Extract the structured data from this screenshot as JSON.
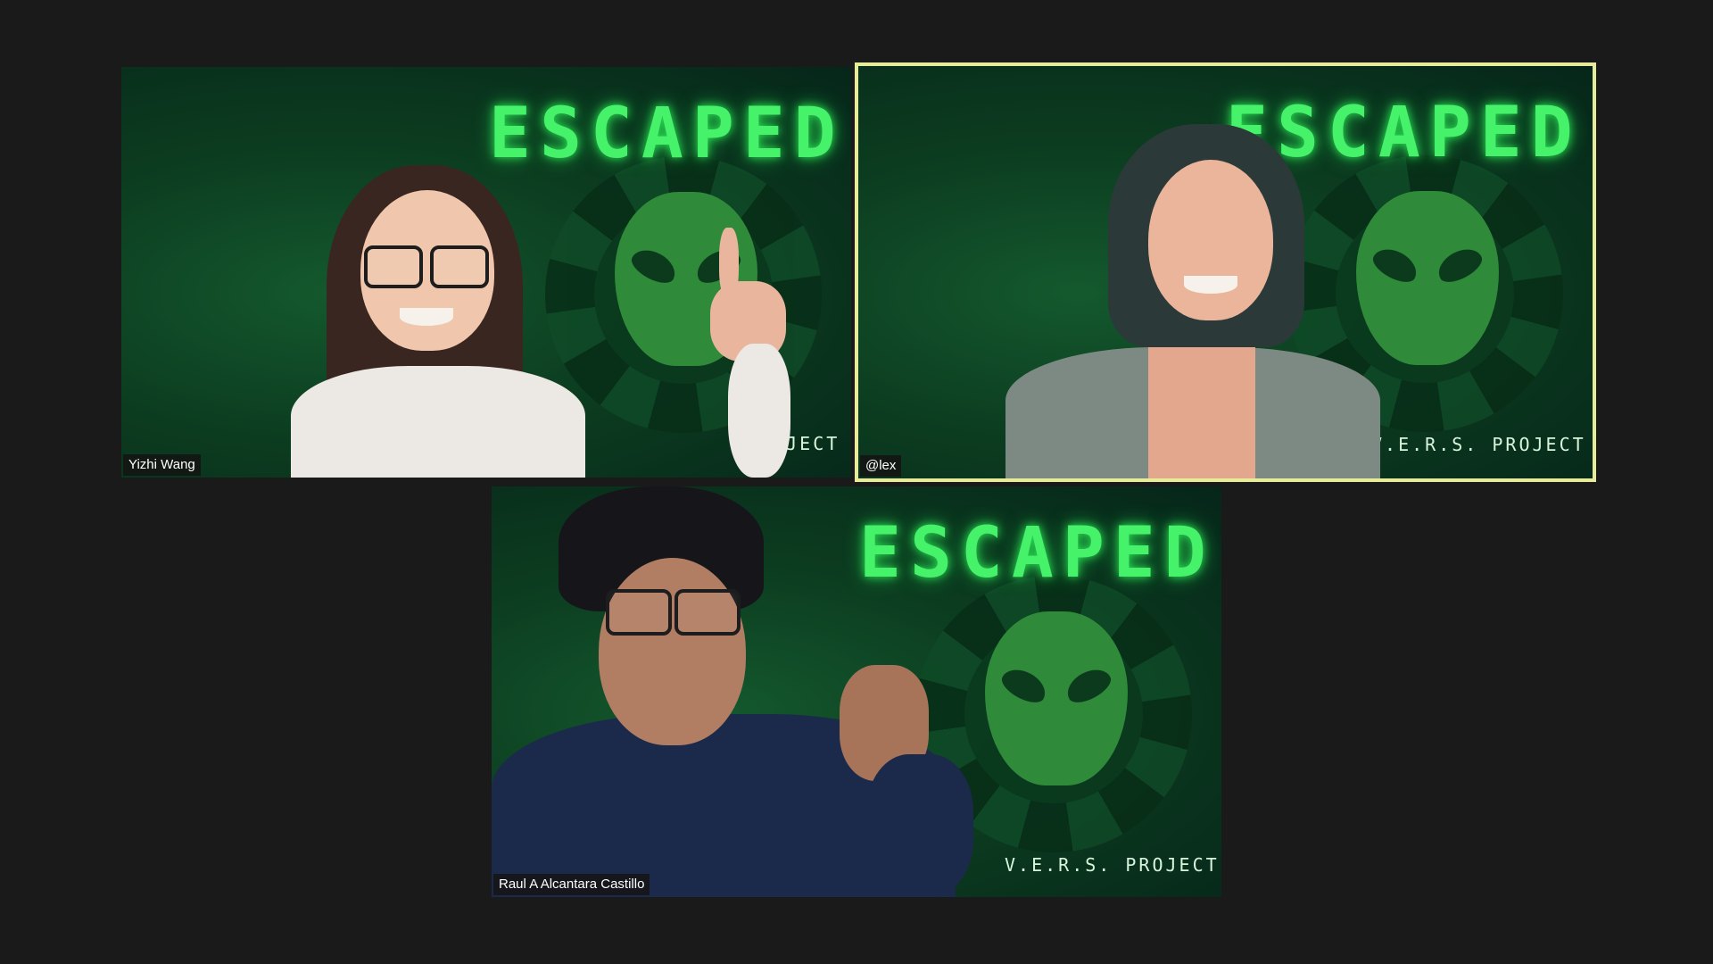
{
  "meeting": {
    "participants": [
      {
        "name": "Yizhi Wang",
        "active_speaker": false,
        "background_title": "ESCAPED",
        "background_subtitle": "PROJECT"
      },
      {
        "name": "@lex",
        "active_speaker": true,
        "background_title": "ESCAPED",
        "background_subtitle": "V.E.R.S. PROJECT"
      },
      {
        "name": "Raul A Alcantara Castillo",
        "active_speaker": false,
        "background_title": "ESCAPED",
        "background_subtitle": "V.E.R.S. PROJECT"
      }
    ]
  },
  "colors": {
    "stage_background": "#1a1a1a",
    "active_speaker_border": "#e6ec9a",
    "title_glow": "#45f26a",
    "virtual_background": "#0c3d20"
  },
  "icons": {
    "background_emblem": "alien-head-icon"
  }
}
